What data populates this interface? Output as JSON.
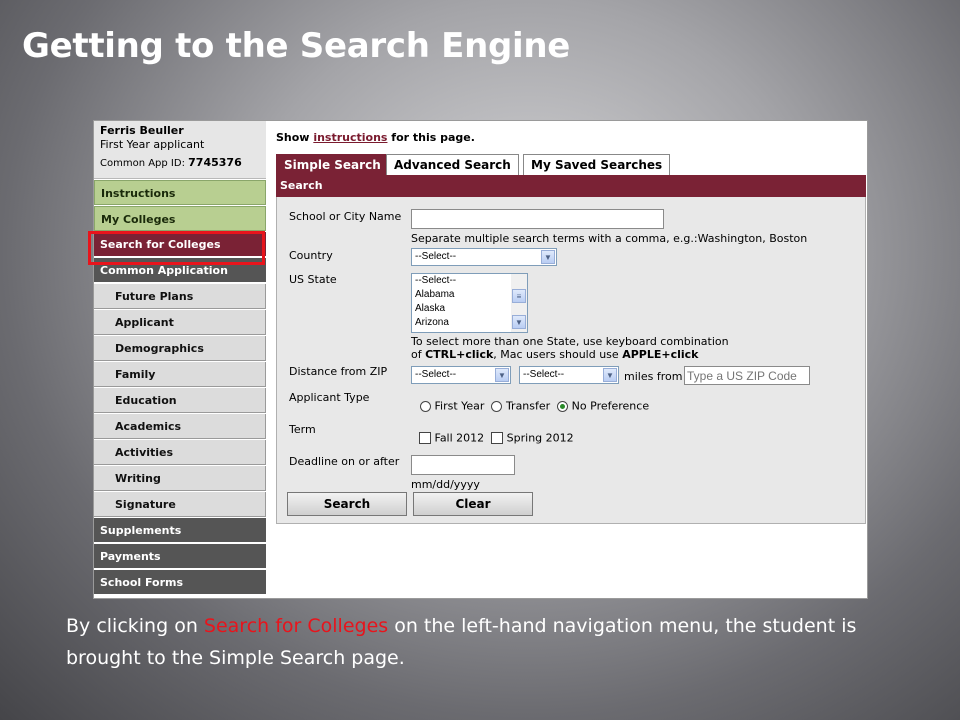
{
  "slide": {
    "title": "Getting to the Search Engine",
    "caption_pre": "By clicking on ",
    "caption_link": "Search for Colleges",
    "caption_post": " on the left-hand navigation menu, the student is brought to the Simple Search page."
  },
  "user": {
    "name": "Ferris Beuller",
    "type": "First Year applicant",
    "app_id_label": "Common App ID: ",
    "app_id": "7745376"
  },
  "nav": {
    "instructions": "Instructions",
    "my_colleges": "My Colleges",
    "search_colleges": "Search for Colleges",
    "common_app": "Common Application",
    "future_plans": "Future Plans",
    "applicant": "Applicant",
    "demographics": "Demographics",
    "family": "Family",
    "education": "Education",
    "academics": "Academics",
    "activities": "Activities",
    "writing": "Writing",
    "signature": "Signature",
    "supplements": "Supplements",
    "payments": "Payments",
    "school_forms": "School Forms"
  },
  "header": {
    "show_pre": "Show ",
    "show_link": "instructions",
    "show_post": " for this page."
  },
  "tabs": {
    "simple": "Simple Search",
    "advanced": "Advanced Search",
    "saved": "My Saved Searches"
  },
  "panel_title": "Search",
  "form": {
    "school_label": "School or City Name",
    "school_value": "",
    "school_hint": "Separate multiple search terms with a comma, e.g.:Washington, Boston",
    "country_label": "Country",
    "country_value": "--Select--",
    "state_label": "US State",
    "state_options": [
      "--Select--",
      "Alabama",
      "Alaska",
      "Arizona"
    ],
    "state_hint_1": "To select more than one State, use keyboard combination",
    "state_hint_2_pre": "of ",
    "state_hint_2_b1": "CTRL+click",
    "state_hint_2_mid": ", Mac users should use ",
    "state_hint_2_b2": "APPLE+click",
    "zip_label": "Distance from ZIP",
    "zip_select1": "--Select--",
    "zip_select2": "--Select--",
    "zip_miles": "miles from",
    "zip_placeholder": "Type a US ZIP Code",
    "applicant_type_label": "Applicant Type",
    "applicant_first": "First Year",
    "applicant_transfer": "Transfer",
    "applicant_nopref": "No Preference",
    "term_label": "Term",
    "term_fall": "Fall 2012",
    "term_spring": "Spring 2012",
    "deadline_label": "Deadline on or after",
    "deadline_hint": "mm/dd/yyyy",
    "search_btn": "Search",
    "clear_btn": "Clear"
  },
  "colors": {
    "accent": "#7a2235",
    "nav_green": "#b8cf91",
    "highlight": "#e8141c"
  }
}
